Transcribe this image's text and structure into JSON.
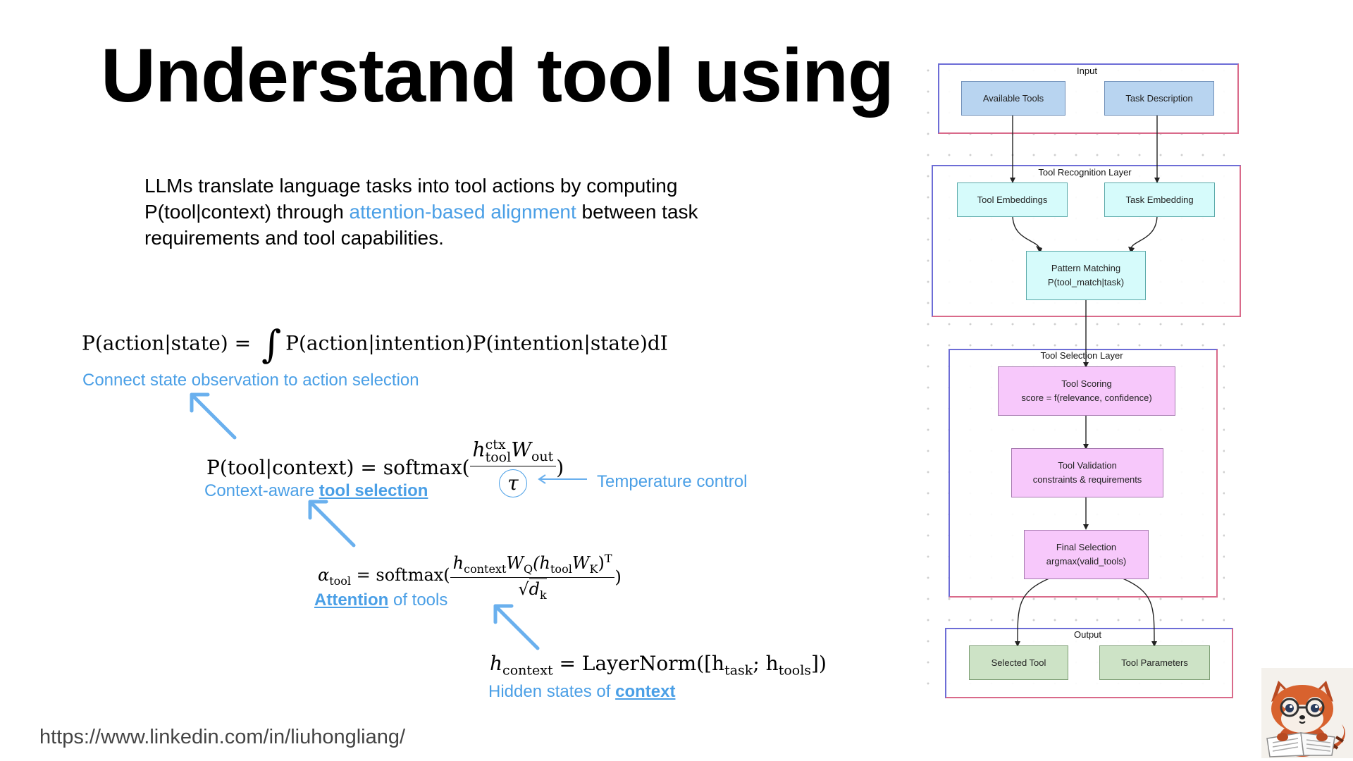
{
  "slide": {
    "title": "Understand tool using",
    "intro_pre": "LLMs translate language tasks into tool actions by computing P(tool|context) through ",
    "intro_highlight": "attention-based alignment",
    "intro_post": " between task requirements and tool capabilities.",
    "footer_url": "https://www.linkedin.com/in/liuhongliang/"
  },
  "equations": {
    "eq1": {
      "left": "P(action|state) = ",
      "integral": "∫",
      "right": "P(action|intention)P(intention|state)dI",
      "caption": "Connect state observation to action selection"
    },
    "eq2": {
      "left": "P(tool|context) = softmax(",
      "num_h": "h",
      "num_sup": "ctx",
      "num_sub": "tool",
      "num_w": "W",
      "num_wsub": "out",
      "den": "τ",
      "close": ")",
      "caption_pre": "Context-aware ",
      "caption_link": "tool selection",
      "temp_label": "Temperature control"
    },
    "eq3": {
      "lhs": "α",
      "lhs_sub": "tool",
      "mid": " = softmax(",
      "num": "h",
      "num_sub1": "context",
      "num_w1": "W",
      "num_w1sub": "Q",
      "num_open": "(h",
      "num_sub2": "tool",
      "num_w2": "W",
      "num_w2sub": "K",
      "num_close": ")",
      "num_sup": "T",
      "den_sqrt": "√",
      "den_d": "d",
      "den_sub": "k",
      "close": ")",
      "caption_link": "Attention",
      "caption_post": " of tools"
    },
    "eq4": {
      "lhs": "h",
      "lhs_sub": "context",
      "mid": " = LayerNorm([h",
      "sub1": "task",
      "sep": "; h",
      "sub2": "tools",
      "close": "])",
      "caption_pre": "Hidden states of ",
      "caption_link": "context"
    }
  },
  "diagram": {
    "groups": {
      "input": "Input",
      "recognition": "Tool Recognition Layer",
      "selection": "Tool Selection Layer",
      "output": "Output"
    },
    "nodes": {
      "available_tools": "Available Tools",
      "task_description": "Task Description",
      "tool_embeddings": "Tool Embeddings",
      "task_embedding": "Task Embedding",
      "pattern_matching_1": "Pattern Matching",
      "pattern_matching_2": "P(tool_match|task)",
      "tool_scoring_1": "Tool Scoring",
      "tool_scoring_2": "score = f(relevance, confidence)",
      "tool_validation_1": "Tool Validation",
      "tool_validation_2": "constraints & requirements",
      "final_selection_1": "Final Selection",
      "final_selection_2": "argmax(valid_tools)",
      "selected_tool": "Selected Tool",
      "tool_parameters": "Tool Parameters"
    },
    "colors": {
      "input": "#b8d4f0",
      "recognition": "#d6fbfb",
      "selection": "#f7c8fb",
      "output": "#cde3c6",
      "accent": "#4a9fe6"
    }
  },
  "icons": {
    "arrow": "up-left-arrow-icon",
    "avatar": "red-panda-reading-avatar"
  }
}
